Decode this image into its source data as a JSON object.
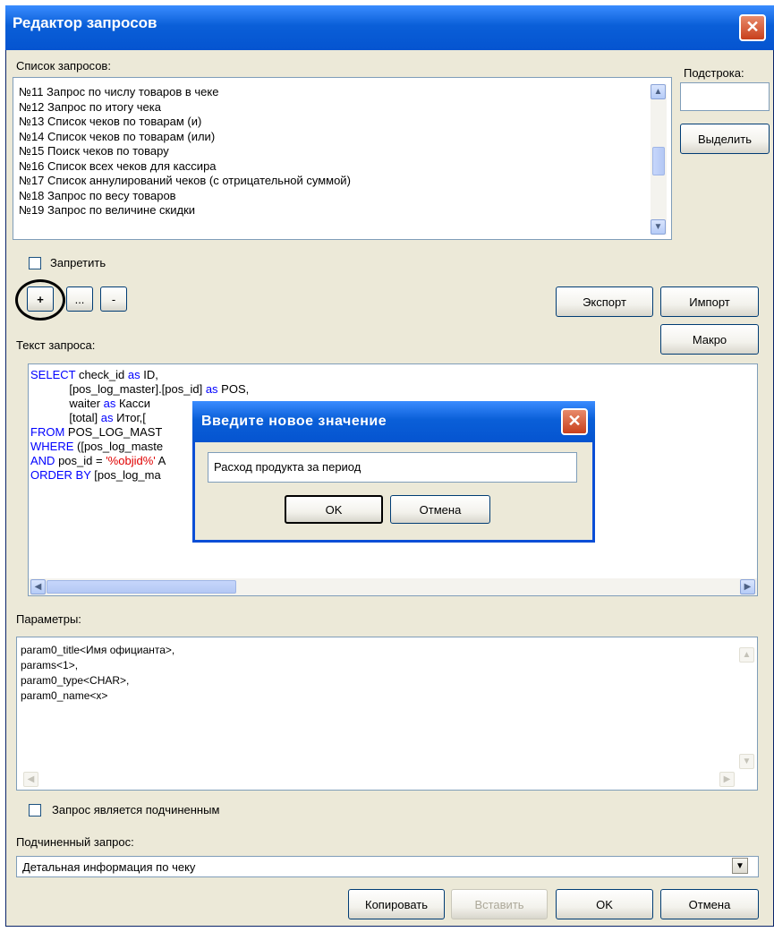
{
  "window": {
    "title": "Редактор запросов",
    "close_glyph": "✕"
  },
  "query_list": {
    "label": "Список запросов:",
    "items": [
      "№11 Запрос по числу товаров в чеке",
      "№12 Запрос по итогу чека",
      "№13 Список чеков по товарам (и)",
      "№14 Список чеков по товарам (или)",
      "№15 Поиск чеков по товару",
      "№16 Список всех чеков для кассира",
      "№17 Список аннулирований чеков (с отрицательной суммой)",
      "№18 Запрос по весу товаров",
      "№19 Запрос по величине скидки"
    ]
  },
  "substring": {
    "label": "Подстрока:",
    "value": "",
    "select_button": "Выделить"
  },
  "disable_checkbox": {
    "label": "Запретить",
    "checked": false
  },
  "toolbar": {
    "add": "+",
    "edit": "...",
    "remove": "-",
    "export": "Экспорт",
    "import": "Импорт",
    "macro": "Макро"
  },
  "query_text": {
    "label": "Текст запроса:",
    "lines": {
      "l1a": "SELECT",
      "l1b": " check_id ",
      "l1c": "as",
      "l1d": " ID,",
      "l2a": "            [pos_log_master].[pos_id] ",
      "l2b": "as",
      "l2c": " POS,",
      "l3a": "            waiter ",
      "l3b": "as",
      "l3c": " Касси",
      "l4a": "            [total] ",
      "l4b": "as",
      "l4c": " Итог,[",
      "l5a": "FROM",
      "l5b": " POS_LOG_MAST",
      "l6a": "WHERE",
      "l6b": " ([pos_log_maste",
      "l7a": "AND",
      "l7b": " pos_id = ",
      "l7c": "'%objid%'",
      "l7d": " A",
      "l8a": "ORDER BY",
      "l8b": " [pos_log_ma"
    }
  },
  "parameters": {
    "label": "Параметры:",
    "lines": [
      "param0_title<Имя официанта>,",
      "params<1>,",
      "param0_type<CHAR>,",
      "param0_name<x>"
    ]
  },
  "subordinate_checkbox": {
    "label": "Запрос является подчиненным",
    "checked": false
  },
  "subordinate_query": {
    "label": "Подчиненный запрос:",
    "value": "Детальная информация по чеку"
  },
  "footer": {
    "copy": "Копировать",
    "paste": "Вставить",
    "ok": "OK",
    "cancel": "Отмена"
  },
  "dialog": {
    "title": "Введите новое значение",
    "close_glyph": "✕",
    "value": "Расход продукта за период",
    "ok": "OK",
    "cancel": "Отмена"
  }
}
